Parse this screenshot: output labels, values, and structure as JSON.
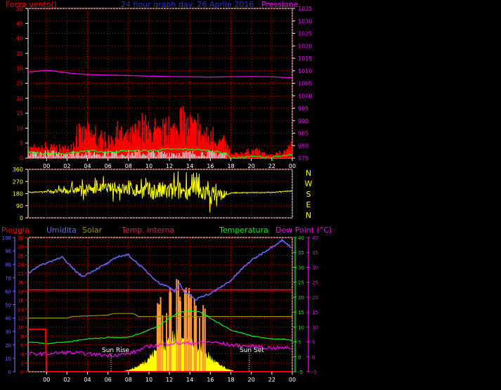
{
  "colors": {
    "background": "#000000",
    "frame": "#ffffff",
    "grid_red": "#cc0000",
    "wind": "#ff0000",
    "wind_avg": "#00ff00",
    "wind_low": "#ffffff",
    "pressure": "#ff00ff",
    "direction": "#ffff00",
    "pioggia": "#ff0000",
    "umidita": "#6666ff",
    "solar": "#ffff00",
    "solar_peaks": "#ff9933",
    "temp_interna": "#cc2255",
    "temperatura": "#00ff00",
    "dew_point": "#ff00ff",
    "solar_line": "#999900"
  },
  "top_panel": {
    "title": "24 hour graph day:  26 Aprile 2016",
    "left_label": "Forza vento()",
    "right_label": "Pressione",
    "left_ticks": [
      "0",
      "5",
      "10",
      "15",
      "20",
      "25",
      "30",
      "35",
      "40",
      "45",
      "50"
    ],
    "right_ticks": [
      "975",
      "980",
      "985",
      "990",
      "995",
      "1000",
      "1005",
      "1010",
      "1015",
      "1020",
      "1025",
      "1030",
      "1035"
    ],
    "x_ticks": [
      "00",
      "02",
      "04",
      "06",
      "08",
      "10",
      "12",
      "14",
      "16",
      "18",
      "20",
      "22",
      "00"
    ]
  },
  "direction_panel": {
    "left_ticks": [
      "0",
      "90",
      "180",
      "270",
      "360"
    ],
    "compass_letters": [
      "N",
      "W",
      "S",
      "E",
      "N"
    ]
  },
  "bottom_panel": {
    "labels": {
      "pioggia": "Pioggia",
      "umidita": "Umidita",
      "solar": "Solar",
      "temp_interna": "Temp. interna",
      "temperatura": "Temperatura",
      "dew_point": "Dew Point (°C)"
    },
    "hum_ticks": [
      "0",
      "10",
      "20",
      "30",
      "40",
      "50",
      "60",
      "70",
      "80",
      "90",
      "100"
    ],
    "rain_ticks": [
      "0",
      "2",
      "4",
      "6",
      "8",
      "10",
      "12",
      "14",
      "16",
      "18",
      "20",
      "22",
      "24",
      "26",
      "28",
      "30"
    ],
    "temp_ticks": [
      "-5",
      "0",
      "5",
      "10",
      "15",
      "20",
      "25",
      "30",
      "35",
      "40"
    ],
    "dew_ticks": [
      "-5",
      "0",
      "5",
      "10",
      "15",
      "20",
      "25",
      "30",
      "35",
      "40"
    ],
    "x_ticks": [
      "00",
      "02",
      "04",
      "06",
      "08",
      "10",
      "12",
      "14",
      "16",
      "18",
      "20",
      "22",
      "00"
    ],
    "sun_rise": "Sun Rise",
    "sun_set": "Sun Set"
  },
  "chart_data": [
    {
      "type": "line",
      "panel": "wind-pressure",
      "x_unit": "hours",
      "xlim": [
        -1.8,
        24
      ],
      "left_ylim": [
        0,
        50
      ],
      "right_ylim": [
        975,
        1035
      ],
      "series": [
        {
          "name": "Pressione",
          "axis": "right",
          "x": [
            -1.8,
            0,
            1,
            2,
            3,
            4,
            6,
            8,
            10,
            12,
            14,
            16,
            18,
            20,
            22,
            23,
            24
          ],
          "values": [
            1009.5,
            1010.2,
            1009.8,
            1009.2,
            1008.8,
            1008.5,
            1008.3,
            1008.1,
            1007.9,
            1007.7,
            1007.6,
            1007.5,
            1007.6,
            1007.7,
            1007.6,
            1007.4,
            1007.2
          ]
        }
      ],
      "wind_gust_envelope": {
        "x": [
          -1.8,
          -1,
          0,
          1,
          2,
          3,
          4,
          5,
          6,
          7,
          8,
          9,
          10,
          11,
          12,
          13,
          14,
          15,
          16,
          17,
          17.6,
          18,
          19,
          20,
          21,
          22,
          23,
          24
        ],
        "values": [
          4,
          3,
          4,
          4,
          3,
          8,
          10,
          7,
          6,
          9,
          8,
          11,
          10,
          9,
          10,
          12,
          13,
          10,
          8,
          6,
          5,
          1,
          2,
          3,
          2,
          1,
          2,
          5
        ]
      },
      "wind_avg": {
        "x": [
          -1.8,
          0,
          2,
          4,
          6,
          8,
          10,
          12,
          14,
          16,
          17.6,
          18,
          20,
          22,
          24
        ],
        "values": [
          2,
          1.5,
          1.5,
          2.5,
          2,
          2.5,
          2.5,
          3,
          3,
          2.5,
          1.5,
          0,
          0.5,
          0.3,
          1
        ]
      },
      "grid": true
    },
    {
      "type": "scatter",
      "panel": "wind-direction",
      "x_unit": "hours",
      "xlim": [
        -1.8,
        24
      ],
      "ylim": [
        0,
        360
      ],
      "trend": {
        "x": [
          -1.8,
          0,
          2,
          4,
          6,
          8,
          10,
          12,
          14,
          16,
          17.6,
          18,
          20,
          22,
          24
        ],
        "values": [
          190,
          195,
          200,
          215,
          225,
          210,
          200,
          195,
          205,
          180,
          170,
          185,
          188,
          190,
          200
        ]
      },
      "spread_deg": {
        "x": [
          0,
          2,
          4,
          6,
          8,
          10,
          12,
          14,
          16,
          17.6
        ],
        "values": [
          10,
          40,
          60,
          60,
          80,
          110,
          120,
          110,
          100,
          60
        ]
      }
    },
    {
      "type": "line",
      "panel": "rain-humidity-solar-temperature",
      "x_unit": "hours",
      "xlim": [
        -1.8,
        24
      ],
      "series": [
        {
          "name": "Umidita",
          "axis": "humidity",
          "ylim": [
            0,
            100
          ],
          "x": [
            -1.8,
            -1,
            0,
            1,
            1.5,
            2,
            3,
            3.5,
            4,
            5,
            6,
            7,
            8,
            9,
            10,
            11,
            12,
            12.5,
            13,
            13.5,
            14,
            14.5,
            15,
            16,
            17,
            18,
            19,
            20,
            21,
            22,
            23,
            24
          ],
          "values": [
            73,
            78,
            81,
            84,
            86,
            81,
            74,
            71,
            73,
            77,
            81,
            86,
            87,
            80,
            73,
            66,
            63,
            60,
            66,
            58,
            58,
            53,
            56,
            58,
            63,
            68,
            76,
            83,
            88,
            93,
            98,
            92
          ]
        },
        {
          "name": "Temperatura",
          "axis": "temperature",
          "ylim": [
            -5,
            40
          ],
          "x": [
            -1.8,
            0,
            2,
            4,
            6,
            8,
            10,
            11,
            12,
            13,
            14,
            15,
            16,
            17,
            18,
            20,
            22,
            23,
            24
          ],
          "values": [
            5,
            4.5,
            5,
            6,
            6.5,
            6.5,
            9,
            10.5,
            13,
            15,
            15.5,
            15,
            13,
            11,
            9,
            7,
            6,
            6,
            5.5
          ]
        },
        {
          "name": "Dew Point",
          "axis": "dewpoint",
          "ylim": [
            -5,
            40
          ],
          "x": [
            -1.8,
            0,
            2,
            4,
            6,
            8,
            10,
            12,
            14,
            16,
            18,
            20,
            22,
            24
          ],
          "values": [
            1,
            1,
            1.5,
            1,
            0.5,
            1,
            3.5,
            4.5,
            4.5,
            5,
            4,
            3.5,
            3,
            3
          ]
        },
        {
          "name": "Temp. interna",
          "axis": "temperature",
          "ylim": [
            -5,
            40
          ],
          "x": [
            -1.8,
            24
          ],
          "values": [
            22.5,
            22.5
          ]
        },
        {
          "name": "Solar",
          "axis": "temperature",
          "ylim": [
            -5,
            40
          ],
          "x": [
            -1.8,
            2,
            2.5,
            6,
            6.5,
            8.5,
            9,
            24
          ],
          "values": [
            13,
            13,
            13.5,
            14,
            14.5,
            14.5,
            13.5,
            13.5
          ]
        },
        {
          "name": "Pioggia",
          "axis": "rain",
          "ylim": [
            0,
            30
          ],
          "x": [
            -1.8,
            -0.1,
            0,
            24
          ],
          "values": [
            9.5,
            9.5,
            0,
            0
          ]
        }
      ],
      "solar_fill": {
        "x": [
          6.6,
          7,
          7.5,
          8,
          8.5,
          9,
          9.5,
          10,
          10.5,
          11,
          11.5,
          12,
          12.5,
          13,
          13.5,
          14,
          14.5,
          15,
          15.5,
          16,
          16.5,
          17,
          17.5,
          18,
          18.5,
          19
        ],
        "values": [
          0,
          0.1,
          0.3,
          0.8,
          1.5,
          2.5,
          4,
          6,
          8,
          10,
          12,
          13,
          13.5,
          14,
          13,
          12,
          11,
          10,
          8,
          6,
          4,
          2.5,
          1.5,
          0.6,
          0.2,
          0
        ]
      },
      "solar_peaks": {
        "x": [
          10.6,
          11.2,
          12.0,
          12.8,
          13.6,
          14.4,
          15.2
        ],
        "values": [
          19,
          20,
          22,
          26,
          23,
          20,
          17
        ]
      },
      "sun_rise_hour": 6.3,
      "sun_set_hour": 19.8,
      "grid": true
    }
  ]
}
